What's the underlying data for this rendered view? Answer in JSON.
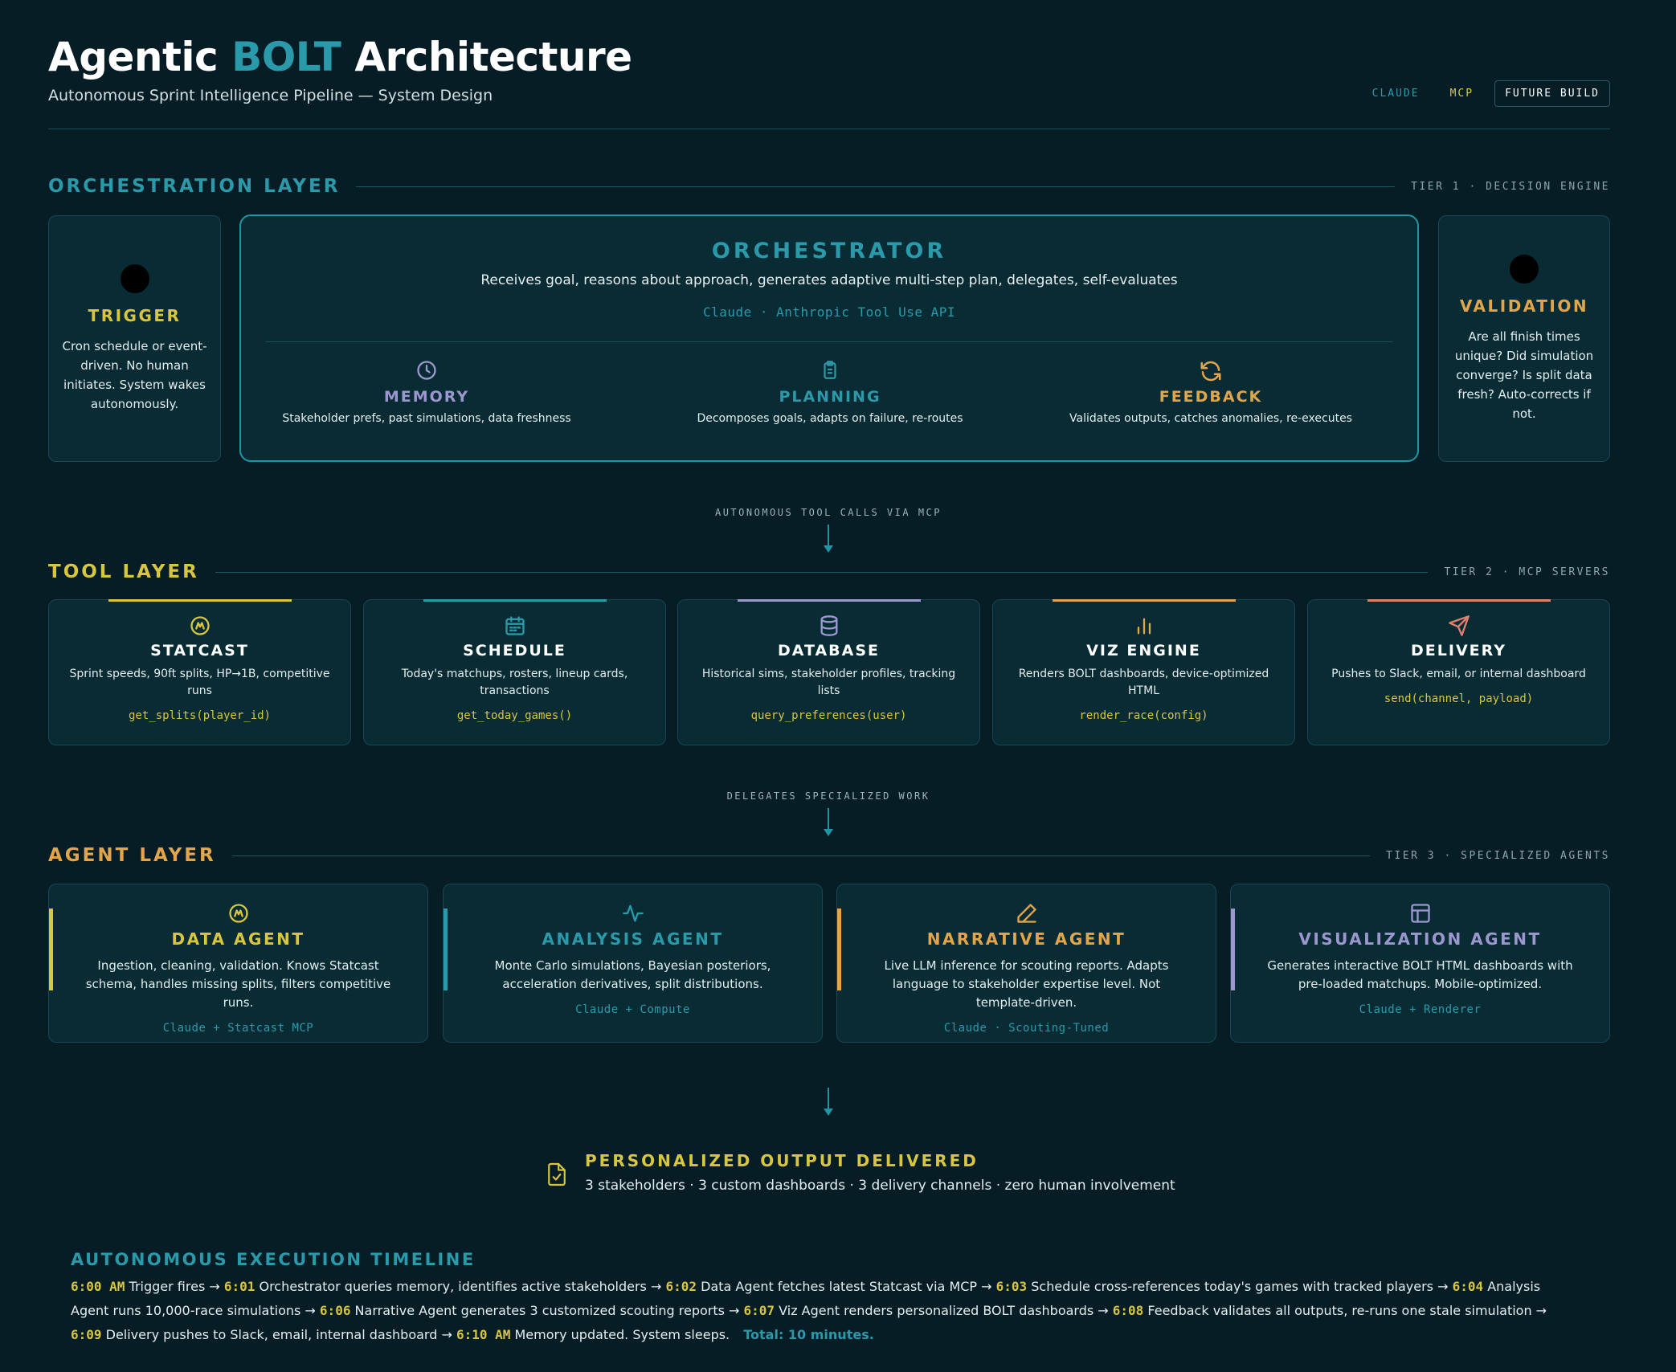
{
  "header": {
    "title_prefix": "Agentic",
    "title_accent": "BOLT",
    "title_suffix": "Architecture",
    "subtitle": "Autonomous Sprint Intelligence Pipeline — System Design",
    "tags": [
      "CLAUDE",
      "MCP",
      "FUTURE BUILD"
    ]
  },
  "colors": {
    "background": "#061d25",
    "teal": "#2a9aaa",
    "yellow": "#d8c640",
    "orange": "#e3a54a",
    "lavender": "#9d97cf",
    "salmon": "#e2806f"
  },
  "orchestration": {
    "title": "ORCHESTRATION LAYER",
    "tier": "TIER 1 · DECISION ENGINE",
    "trigger": {
      "name": "TRIGGER",
      "desc": "Cron schedule or event-driven. No human initiates. System wakes autonomously."
    },
    "orchestrator": {
      "name": "ORCHESTRATOR",
      "desc": "Receives goal, reasons about approach, generates adaptive multi-step plan, delegates, self-evaluates",
      "api": "Claude · Anthropic Tool Use API",
      "subs": [
        {
          "name": "MEMORY",
          "icon": "clock-icon",
          "desc": "Stakeholder prefs, past simulations, data freshness"
        },
        {
          "name": "PLANNING",
          "icon": "clipboard-icon",
          "desc": "Decomposes goals, adapts on failure, re-routes"
        },
        {
          "name": "FEEDBACK",
          "icon": "refresh-icon",
          "desc": "Validates outputs, catches anomalies, re-executes"
        }
      ]
    },
    "validation": {
      "name": "VALIDATION",
      "desc": "Are all finish times unique? Did simulation converge? Is split data fresh? Auto-corrects if not."
    }
  },
  "connectors": {
    "c1": "AUTONOMOUS TOOL CALLS VIA MCP",
    "c2": "DELEGATES SPECIALIZED WORK"
  },
  "tools": {
    "title": "TOOL LAYER",
    "tier": "TIER 2 · MCP SERVERS",
    "items": [
      {
        "name": "STATCAST",
        "icon": "gauge-icon",
        "desc": "Sprint speeds, 90ft splits, HP→1B, competitive runs",
        "fn": "get_splits(player_id)"
      },
      {
        "name": "SCHEDULE",
        "icon": "calendar-icon",
        "desc": "Today's matchups, rosters, lineup cards, transactions",
        "fn": "get_today_games()"
      },
      {
        "name": "DATABASE",
        "icon": "database-icon",
        "desc": "Historical sims, stakeholder profiles, tracking lists",
        "fn": "query_preferences(user)"
      },
      {
        "name": "VIZ ENGINE",
        "icon": "bar-chart-icon",
        "desc": "Renders BOLT dashboards, device-optimized HTML",
        "fn": "render_race(config)"
      },
      {
        "name": "DELIVERY",
        "icon": "send-icon",
        "desc": "Pushes to Slack, email, or internal dashboard",
        "fn": "send(channel, payload)"
      }
    ]
  },
  "agents": {
    "title": "AGENT LAYER",
    "tier": "TIER 3 · SPECIALIZED AGENTS",
    "items": [
      {
        "name": "DATA AGENT",
        "icon": "gauge-icon",
        "desc": "Ingestion, cleaning, validation. Knows Statcast schema, handles missing splits, filters competitive runs.",
        "tech": "Claude + Statcast MCP"
      },
      {
        "name": "ANALYSIS AGENT",
        "icon": "activity-icon",
        "desc": "Monte Carlo simulations, Bayesian posteriors, acceleration derivatives, split distributions.",
        "tech": "Claude + Compute"
      },
      {
        "name": "NARRATIVE AGENT",
        "icon": "pencil-icon",
        "desc": "Live LLM inference for scouting reports. Adapts language to stakeholder expertise level. Not template-driven.",
        "tech": "Claude · Scouting-Tuned"
      },
      {
        "name": "VISUALIZATION AGENT",
        "icon": "layout-icon",
        "desc": "Generates interactive BOLT HTML dashboards with pre-loaded matchups. Mobile-optimized.",
        "tech": "Claude + Renderer"
      }
    ]
  },
  "output": {
    "title": "PERSONALIZED OUTPUT DELIVERED",
    "desc": "3 stakeholders · 3 custom dashboards · 3 delivery channels · zero human involvement"
  },
  "timeline": {
    "title": "AUTONOMOUS EXECUTION TIMELINE",
    "steps": [
      {
        "time": "6:00 AM",
        "text": "Trigger fires"
      },
      {
        "time": "6:01",
        "text": "Orchestrator queries memory, identifies active stakeholders"
      },
      {
        "time": "6:02",
        "text": "Data Agent fetches latest Statcast via MCP"
      },
      {
        "time": "6:03",
        "text": "Schedule cross-references today's games with tracked players"
      },
      {
        "time": "6:04",
        "text": "Analysis Agent runs 10,000-race simulations"
      },
      {
        "time": "6:06",
        "text": "Narrative Agent generates 3 customized scouting reports"
      },
      {
        "time": "6:07",
        "text": "Viz Agent renders personalized BOLT dashboards"
      },
      {
        "time": "6:08",
        "text": "Feedback validates all outputs, re-runs one stale simulation"
      },
      {
        "time": "6:09",
        "text": "Delivery pushes to Slack, email, internal dashboard"
      },
      {
        "time": "6:10 AM",
        "text": "Memory updated. System sleeps."
      }
    ],
    "total": "Total: 10 minutes."
  }
}
